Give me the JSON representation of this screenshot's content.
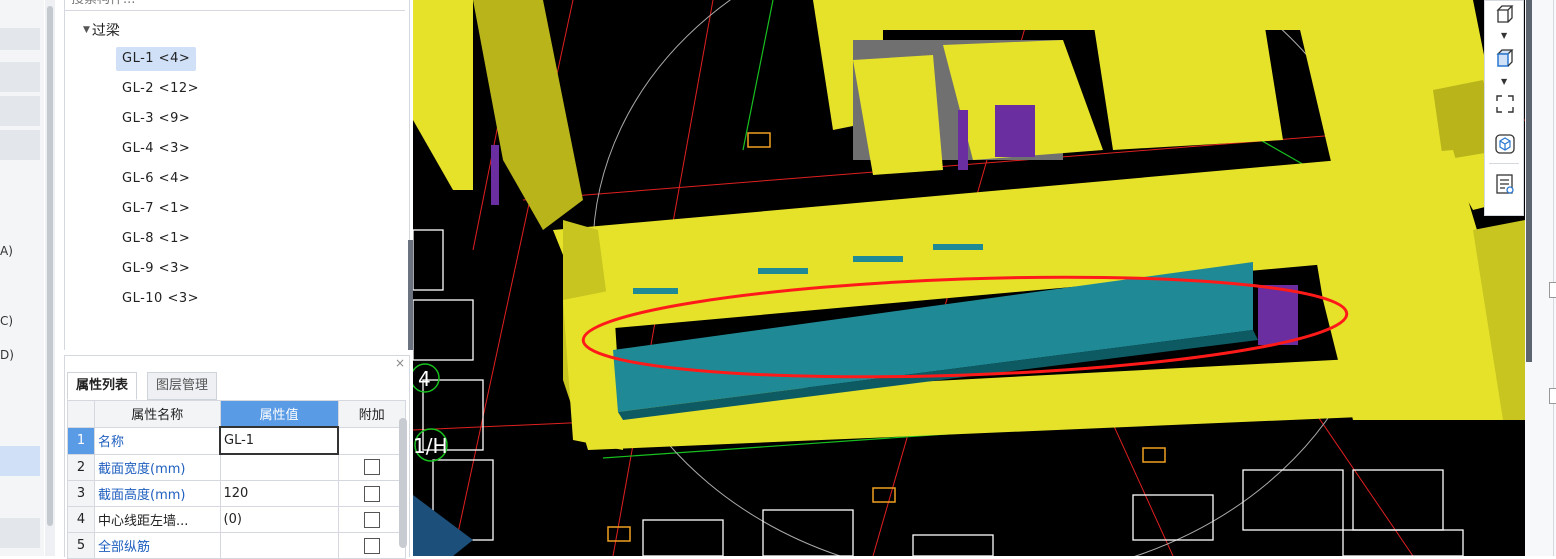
{
  "search": {
    "placeholder": "搜索构件..."
  },
  "left_strip": {
    "labels": [
      "A)",
      "C)",
      "D)"
    ]
  },
  "tree": {
    "root_label": "过梁",
    "items": [
      {
        "label": "GL-1 <4>",
        "selected": true
      },
      {
        "label": "GL-2 <12>"
      },
      {
        "label": "GL-3 <9>"
      },
      {
        "label": "GL-4 <3>"
      },
      {
        "label": "GL-6 <4>"
      },
      {
        "label": "GL-7 <1>"
      },
      {
        "label": "GL-8 <1>"
      },
      {
        "label": "GL-9 <3>"
      },
      {
        "label": "GL-10 <3>"
      }
    ]
  },
  "properties": {
    "tabs": [
      "属性列表",
      "图层管理"
    ],
    "columns": [
      "属性名称",
      "属性值",
      "附加"
    ],
    "rows": [
      {
        "num": "1",
        "name": "名称",
        "value": "GL-1",
        "attach": false,
        "has_checkbox": false
      },
      {
        "num": "2",
        "name": "截面宽度(mm)",
        "value": "",
        "attach": false,
        "has_checkbox": true
      },
      {
        "num": "3",
        "name": "截面高度(mm)",
        "value": "120",
        "attach": false,
        "has_checkbox": true
      },
      {
        "num": "4",
        "name": "中心线距左墙...",
        "value": "(0)",
        "attach": false,
        "has_checkbox": true
      },
      {
        "num": "5",
        "name": "全部纵筋",
        "value": "",
        "attach": false,
        "has_checkbox": true
      }
    ],
    "close_glyph": "×"
  },
  "viewport": {
    "axis_labels": [
      "4",
      "1/H"
    ],
    "colors": {
      "wall": "#e6e22a",
      "wall_shade": "#b8b41a",
      "beam": "#1f8a96",
      "grid": "#e02020",
      "dim": "#18c01f",
      "highlight": "#ff1a1a"
    }
  },
  "toolbar": {
    "icons": [
      "cube-view-icon",
      "cube-front-icon",
      "fit-view-icon",
      "3d-view-icon",
      "property-view-icon"
    ]
  }
}
